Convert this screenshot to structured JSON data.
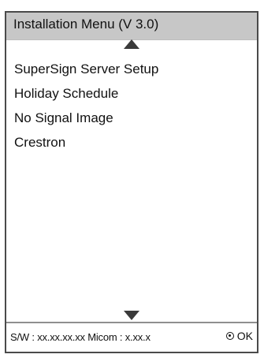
{
  "header": {
    "title": "Installation Menu (V 3.0)"
  },
  "menu": {
    "items": [
      {
        "label": "SuperSign Server Setup"
      },
      {
        "label": "Holiday Schedule"
      },
      {
        "label": "No Signal Image"
      },
      {
        "label": "Crestron"
      }
    ]
  },
  "status_bar": {
    "info": "S/W : xx.xx.xx.xx Micom : x.xx.x",
    "ok_label": "OK",
    "ok_icon": "ok-circle-icon"
  },
  "icons": {
    "scroll_up": "triangle-up-icon",
    "scroll_down": "triangle-down-icon"
  },
  "colors": {
    "header_bg": "#c7c7c7",
    "border": "#4a4a4a",
    "arrow": "#3a3a3a",
    "text": "#111111"
  }
}
